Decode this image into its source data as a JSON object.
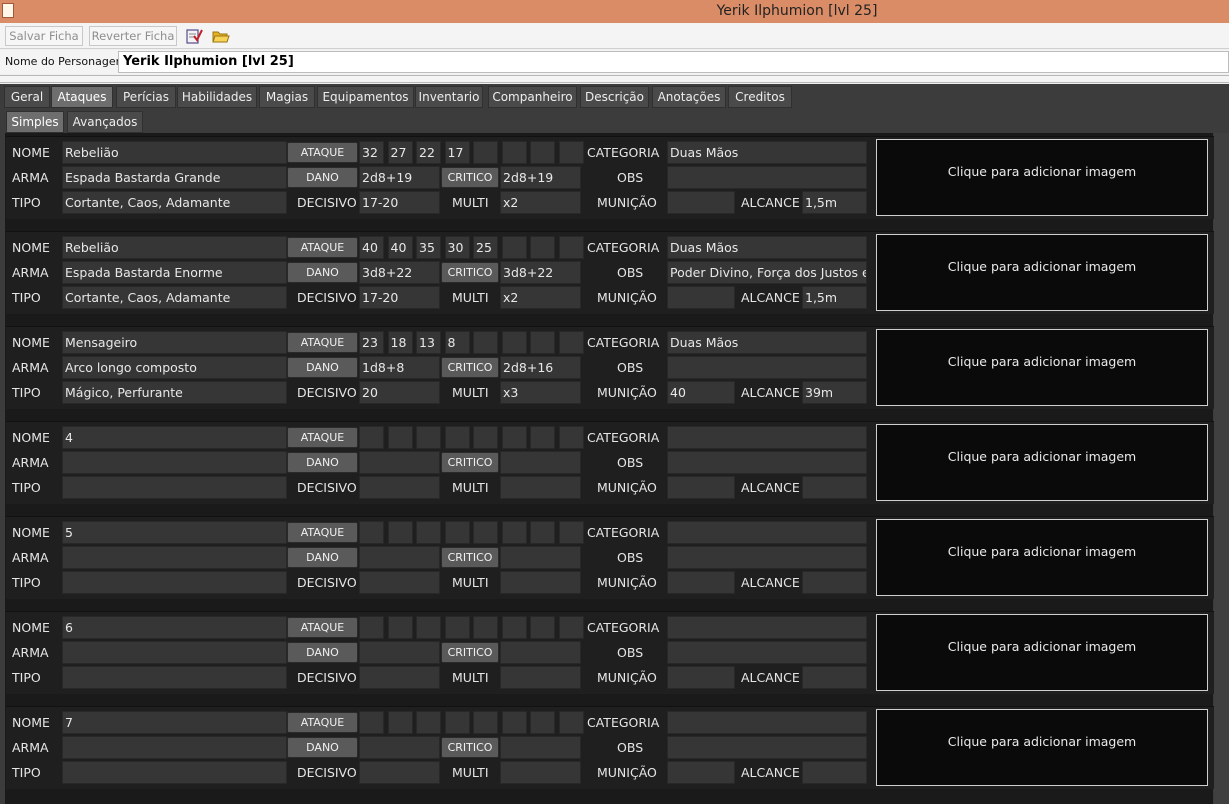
{
  "window": {
    "title": "Yerik Ilphumion [lvl 25]"
  },
  "toolbar": {
    "save_label": "Salvar Ficha",
    "revert_label": "Reverter Ficha",
    "icon1": "notebook-check-icon",
    "icon2": "folder-open-icon"
  },
  "character": {
    "name_label": "Nome do Personagem:",
    "name_value": "Yerik Ilphumion [lvl 25]"
  },
  "tabs": [
    "Geral",
    "Ataques",
    "Perícias",
    "Habilidades",
    "Magias",
    "Equipamentos",
    "Inventario",
    "Companheiro",
    "Descrição",
    "Anotações",
    "Creditos"
  ],
  "active_tab": "Ataques",
  "subtabs": [
    "Simples",
    "Avançados"
  ],
  "active_subtab": "Simples",
  "labels": {
    "nome": "NOME",
    "arma": "ARMA",
    "tipo": "TIPO",
    "ataque": "ATAQUE",
    "dano": "DANO",
    "decisivo": "DECISIVO",
    "critico": "CRITICO",
    "multi": "MULTI",
    "categoria": "CATEGORIA",
    "obs": "OBS",
    "municao": "MUNIÇÃO",
    "alcance": "ALCANCE",
    "image_placeholder": "Clique para adicionar imagem"
  },
  "attacks": [
    {
      "nome": "Rebelião",
      "arma": "Espada Bastarda Grande",
      "tipo": "Cortante, Caos, Adamante",
      "ataque": [
        "32",
        "27",
        "22",
        "17",
        "",
        "",
        "",
        ""
      ],
      "dano": "2d8+19",
      "critico": "2d8+19",
      "decisivo": "17-20",
      "multi": "x2",
      "categoria": "Duas Mãos",
      "obs": "",
      "municao": "",
      "alcance": "1,5m"
    },
    {
      "nome": "Rebelião",
      "arma": "Espada Bastarda Enorme",
      "tipo": "Cortante, Caos, Adamante",
      "ataque": [
        "40",
        "40",
        "35",
        "30",
        "25",
        "",
        "",
        ""
      ],
      "dano": "3d8+22",
      "critico": "3d8+22",
      "decisivo": "17-20",
      "multi": "x2",
      "categoria": "Duas Mãos",
      "obs": "Poder Divino, Força dos Justos e V",
      "municao": "",
      "alcance": "1,5m"
    },
    {
      "nome": "Mensageiro",
      "arma": "Arco longo composto",
      "tipo": "Mágico, Perfurante",
      "ataque": [
        "23",
        "18",
        "13",
        "8",
        "",
        "",
        "",
        ""
      ],
      "dano": "1d8+8",
      "critico": "2d8+16",
      "decisivo": "20",
      "multi": "x3",
      "categoria": "Duas Mãos",
      "obs": "",
      "municao": "40",
      "alcance": "39m"
    },
    {
      "nome": "4",
      "arma": "",
      "tipo": "",
      "ataque": [
        "",
        "",
        "",
        "",
        "",
        "",
        "",
        ""
      ],
      "dano": "",
      "critico": "",
      "decisivo": "",
      "multi": "",
      "categoria": "",
      "obs": "",
      "municao": "",
      "alcance": ""
    },
    {
      "nome": "5",
      "arma": "",
      "tipo": "",
      "ataque": [
        "",
        "",
        "",
        "",
        "",
        "",
        "",
        ""
      ],
      "dano": "",
      "critico": "",
      "decisivo": "",
      "multi": "",
      "categoria": "",
      "obs": "",
      "municao": "",
      "alcance": ""
    },
    {
      "nome": "6",
      "arma": "",
      "tipo": "",
      "ataque": [
        "",
        "",
        "",
        "",
        "",
        "",
        "",
        ""
      ],
      "dano": "",
      "critico": "",
      "decisivo": "",
      "multi": "",
      "categoria": "",
      "obs": "",
      "municao": "",
      "alcance": ""
    },
    {
      "nome": "7",
      "arma": "",
      "tipo": "",
      "ataque": [
        "",
        "",
        "",
        "",
        "",
        "",
        "",
        ""
      ],
      "dano": "",
      "critico": "",
      "decisivo": "",
      "multi": "",
      "categoria": "",
      "obs": "",
      "municao": "",
      "alcance": ""
    }
  ]
}
